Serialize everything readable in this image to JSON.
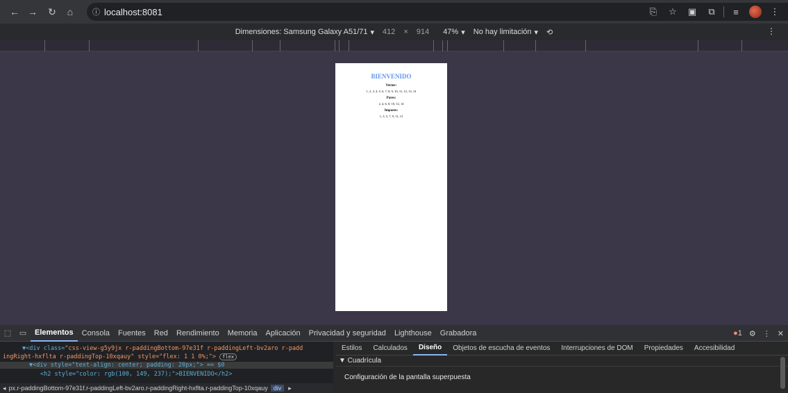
{
  "browser": {
    "url": "localhost:8081",
    "icons": [
      "back-icon",
      "forward-icon",
      "reload-icon",
      "home-icon",
      "info-icon",
      "translate-icon",
      "star-icon",
      "screenshot-icon",
      "extensions-icon",
      "reading-list-icon",
      "profile-icon",
      "menu-icon"
    ]
  },
  "device_toolbar": {
    "device": "Dimensiones: Samsung Galaxy A51/71",
    "width": "412",
    "x": "×",
    "height": "914",
    "zoom": "47%",
    "throttle": "No hay limitación"
  },
  "page": {
    "title": "BIENVENIDO",
    "vector_label": "Vector:",
    "vector_values": "1, 2, 3, 4, 5, 6, 7, 8, 9, 10, 11, 12, 13, 14",
    "pares_label": "Pares:",
    "pares_values": "2, 4, 6, 8, 10, 12, 14",
    "impares_label": "Impares:",
    "impares_values": "1, 3, 5, 7, 9, 11, 13"
  },
  "devtools": {
    "tabs": [
      "Elementos",
      "Consola",
      "Fuentes",
      "Red",
      "Rendimiento",
      "Memoria",
      "Aplicación",
      "Privacidad y seguridad",
      "Lighthouse",
      "Grabadora"
    ],
    "active_tab": "Elementos",
    "error_count": "1",
    "side_tabs": [
      "Estilos",
      "Calculados",
      "Diseño",
      "Objetos de escucha de eventos",
      "Interrupciones de DOM",
      "Propiedades",
      "Accesibilidad"
    ],
    "active_side_tab": "Diseño",
    "section_title": "▼ Cuadrícula",
    "subsection": "Configuración de la pantalla superpuesta",
    "el_line1_tag": "▼<div class=",
    "el_line1_val": "\"css-view-g5y9jx r-paddingBottom-97e31f r-paddingLeft-bv2aro r-padd",
    "el_line2": "ingRight-hxflta r-paddingTop-10xqauy\" style=\"flex: 1 1 0%;\">",
    "el_line2_badge": "flex",
    "el_line3": "▼<div style=\"text-align: center; padding: 20px;\"> == $0",
    "el_line4": "<h2 style=\"color: rgb(100, 149, 237);\">BIENVENIDO</h2>",
    "breadcrumb": "px.r-paddingBottom-97e31f.r-paddingLeft-bv2aro.r-paddingRight-hxflta.r-paddingTop-10xqauy",
    "breadcrumb_sel": "div"
  }
}
